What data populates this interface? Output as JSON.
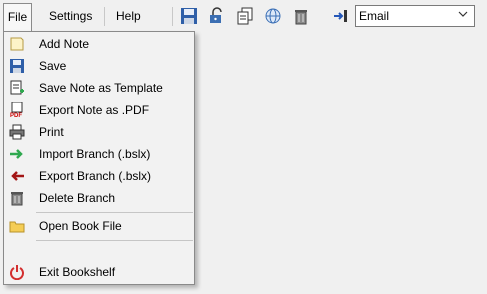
{
  "menubar": {
    "file": "File",
    "settings": "Settings",
    "help": "Help"
  },
  "toolbar": {
    "icons": [
      "save-icon",
      "unlock-icon",
      "copy-icon",
      "globe-icon",
      "trash-icon",
      "import-arrow-icon"
    ],
    "select_value": "Email"
  },
  "file_menu": {
    "items": [
      {
        "label": "Add Note",
        "icon": "note-icon"
      },
      {
        "label": "Save",
        "icon": "save-icon"
      },
      {
        "label": "Save Note as Template",
        "icon": "template-icon"
      },
      {
        "label": "Export Note as .PDF",
        "icon": "pdf-icon"
      },
      {
        "label": "Print",
        "icon": "printer-icon"
      },
      {
        "label": "Import Branch (.bslx)",
        "icon": "green-arrow-right-icon"
      },
      {
        "label": "Export Branch (.bslx)",
        "icon": "red-arrow-left-icon"
      },
      {
        "label": "Delete Branch",
        "icon": "trash-icon"
      },
      {
        "label": "Open Book File",
        "icon": "folder-icon"
      },
      {
        "label": "Exit Bookshelf",
        "icon": "power-icon"
      }
    ]
  },
  "colors": {
    "background": "#f0f0f0",
    "menu_border": "#8a8a8a",
    "power_red": "#d32f2f",
    "import_green": "#2fa84f",
    "export_red": "#a31515"
  }
}
